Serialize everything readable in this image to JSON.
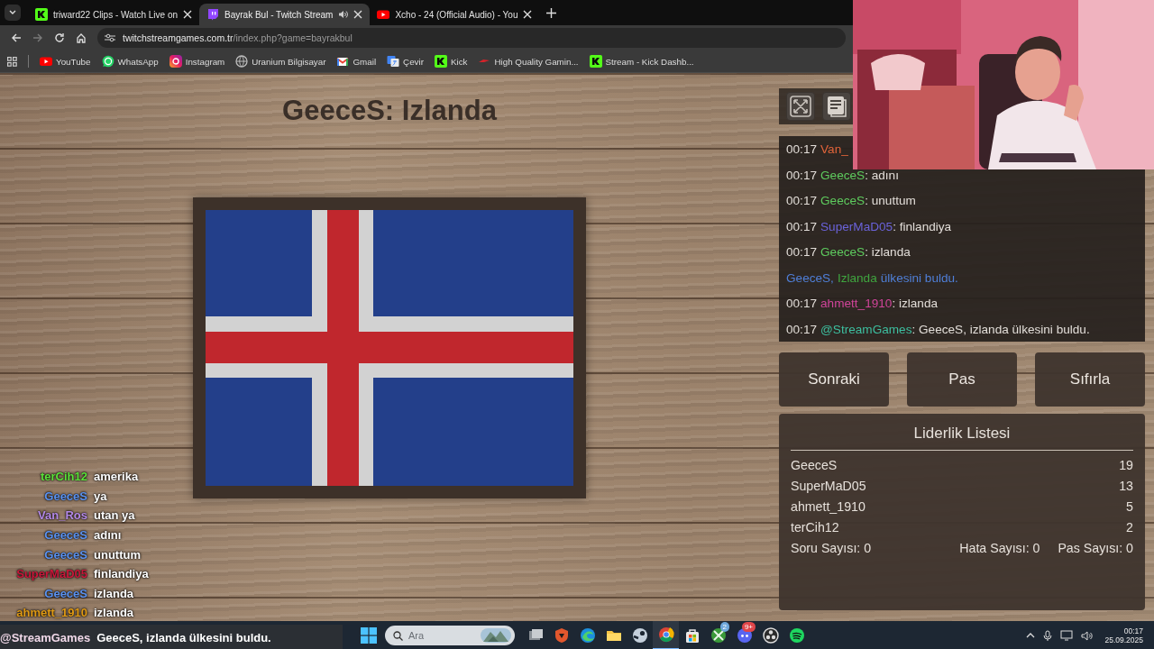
{
  "browser": {
    "tabs": [
      {
        "kind": "kick",
        "title": "triward22 Clips - Watch Live on",
        "selected": false,
        "audio": false
      },
      {
        "kind": "twitch",
        "title": "Bayrak Bul - Twitch Stream",
        "selected": true,
        "audio": true
      },
      {
        "kind": "youtube",
        "title": "Xcho - 24 (Official Audio) - You",
        "selected": false,
        "audio": false
      }
    ],
    "url_host": "twitchstreamgames.com.tr",
    "url_path": "/index.php?game=bayrakbul",
    "bookmarks": [
      {
        "kind": "youtube",
        "label": "YouTube"
      },
      {
        "kind": "whatsapp",
        "label": "WhatsApp"
      },
      {
        "kind": "instagram",
        "label": "Instagram"
      },
      {
        "kind": "globe",
        "label": "Uranium Bilgisayar"
      },
      {
        "kind": "gmail",
        "label": "Gmail"
      },
      {
        "kind": "translate",
        "label": "Çevir"
      },
      {
        "kind": "kick",
        "label": "Kick"
      },
      {
        "kind": "dash",
        "label": "High Quality Gamin..."
      },
      {
        "kind": "kick",
        "label": "Stream - Kick Dashb..."
      }
    ]
  },
  "game": {
    "title": "GeeceS: Izlanda"
  },
  "chat": [
    {
      "kind": "message",
      "time": "00:17",
      "user": "Van_",
      "color": "#e0643a"
    },
    {
      "kind": "message",
      "time": "00:17",
      "user": "GeeceS",
      "color": "#5ecb5e",
      "text": ": adını"
    },
    {
      "kind": "message",
      "time": "00:17",
      "user": "GeeceS",
      "color": "#5ecb5e",
      "text": ": unuttum"
    },
    {
      "kind": "message",
      "time": "00:17",
      "user": "SuperMaD05",
      "color": "#6a62d8",
      "text": ": finlandiya"
    },
    {
      "kind": "message",
      "time": "00:17",
      "user": "GeeceS",
      "color": "#5ecb5e",
      "text": ": izlanda"
    },
    {
      "kind": "notice",
      "parts": [
        {
          "text": "GeeceS,",
          "color": "#4f7fd8"
        },
        {
          "text": "Izlanda",
          "color": "#3fa53f"
        },
        {
          "text": "ülkesini buldu.",
          "color": "#4f7fd8"
        }
      ]
    },
    {
      "kind": "message",
      "time": "00:17",
      "user": "ahmett_1910",
      "color": "#d0449a",
      "text": ": izlanda"
    },
    {
      "kind": "message",
      "time": "00:17",
      "user": "@StreamGames",
      "color": "#3dbfa0",
      "text": ": GeeceS, izlanda ülkesini buldu."
    }
  ],
  "buttons": [
    {
      "label": "Sonraki"
    },
    {
      "label": "Pas"
    },
    {
      "label": "Sıfırla"
    }
  ],
  "leaderboard": {
    "title": "Liderlik Listesi",
    "rows": [
      {
        "name": "GeeceS",
        "score": "19"
      },
      {
        "name": "SuperMaD05",
        "score": "13"
      },
      {
        "name": "ahmett_1910",
        "score": "5"
      },
      {
        "name": "terCih12",
        "score": "2"
      }
    ],
    "stats": [
      "Soru Sayısı: 0",
      "Hata Sayısı: 0",
      "Pas Sayısı: 0"
    ]
  },
  "stream_chat": [
    {
      "user": "terCih12",
      "color": "#5be03a",
      "text": "amerika"
    },
    {
      "user": "GeeceS",
      "color": "#5a92f0",
      "text": "ya"
    },
    {
      "user": "Van_Ros",
      "color": "#b58ae8",
      "text": "utan ya"
    },
    {
      "user": "GeeceS",
      "color": "#5a92f0",
      "text": "adını"
    },
    {
      "user": "GeeceS",
      "color": "#5a92f0",
      "text": "unuttum"
    },
    {
      "user": "SuperMaD05",
      "color": "#c8173a",
      "text": "finlandiya"
    },
    {
      "user": "GeeceS",
      "color": "#5a92f0",
      "text": "izlanda"
    },
    {
      "user": "ahmett_1910",
      "color": "#e09a14",
      "text": "izlanda"
    }
  ],
  "stream_alert": {
    "user": "@StreamGames",
    "text": "GeeceS, izlanda ülkesini buldu."
  },
  "taskbar": {
    "search_placeholder": "Ara",
    "apps": [
      {
        "kind": "taskview",
        "active": false
      },
      {
        "kind": "shield",
        "active": false
      },
      {
        "kind": "edge",
        "active": false
      },
      {
        "kind": "folder",
        "active": false
      },
      {
        "kind": "steam",
        "active": false
      },
      {
        "kind": "chrome",
        "active": true
      },
      {
        "kind": "store",
        "active": false
      },
      {
        "kind": "xbox",
        "active": false,
        "badge": "2"
      },
      {
        "kind": "discord",
        "active": false,
        "badge": "9+"
      },
      {
        "kind": "obs",
        "active": false
      },
      {
        "kind": "spotify",
        "active": false
      }
    ],
    "time": "00:17",
    "date": "25.09.2025"
  }
}
